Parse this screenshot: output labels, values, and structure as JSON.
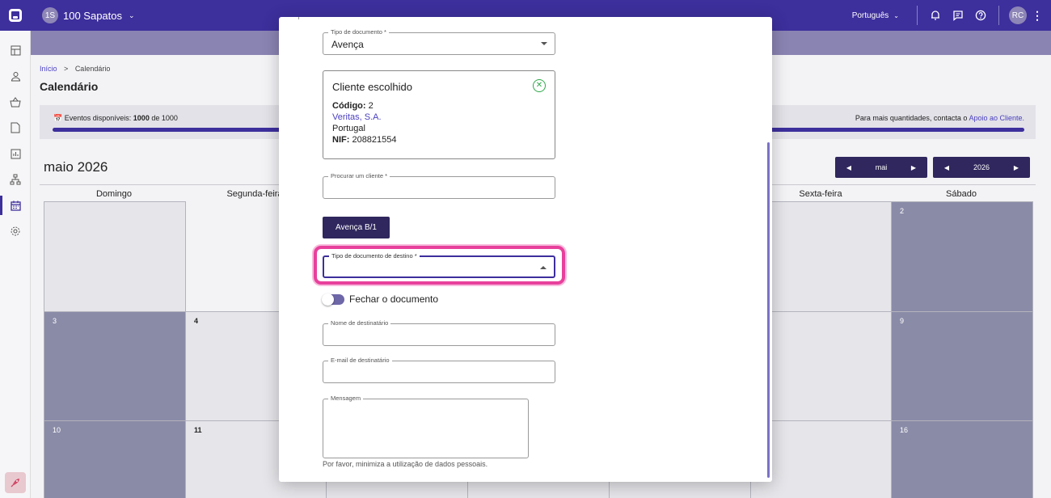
{
  "topbar": {
    "company_badge": "1S",
    "company_name": "100 Sapatos",
    "language": "Português",
    "avatar_initials": "RC"
  },
  "breadcrumb": {
    "home": "Início",
    "separator": ">",
    "current": "Calendário"
  },
  "page": {
    "title": "Calendário"
  },
  "events": {
    "label": "Eventos disponíveis:",
    "used": "1000",
    "of": "de 1000",
    "more_text": "Para mais quantidades, contacta o",
    "support_link": "Apoio ao Cliente."
  },
  "calendar": {
    "month_title": "maio 2026",
    "month_nav_value": "mai",
    "year_nav_value": "2026",
    "day_names": [
      "Domingo",
      "Segunda-feira",
      "Sexta-feira",
      "Sábado"
    ],
    "cells": [
      "2",
      "3",
      "4",
      "9",
      "10",
      "11",
      "16"
    ]
  },
  "modal": {
    "doc_type": {
      "label": "Tipo de documento *",
      "value": "Avença"
    },
    "client": {
      "title": "Cliente escolhido",
      "code_label": "Código:",
      "code_value": "2",
      "name": "Veritas, S.A.",
      "country": "Portugal",
      "nif_label": "NIF:",
      "nif_value": "208821554"
    },
    "search_client": {
      "label": "Procurar um cliente *",
      "value": ""
    },
    "doc_button": "Avença B/1",
    "dest_doc_type": {
      "label": "Tipo de documento de destino *",
      "value": ""
    },
    "close_doc_label": "Fechar o documento",
    "recipient_name": {
      "label": "Nome de destinatário",
      "value": ""
    },
    "recipient_email": {
      "label": "E-mail de destinatário",
      "value": ""
    },
    "message": {
      "label": "Mensagem",
      "value": ""
    },
    "hint": "Por favor, minimiza a utilização de dados pessoais."
  },
  "colors": {
    "brand": "#3d2f9c",
    "highlight": "#e8409c",
    "success": "#2ea84a"
  }
}
